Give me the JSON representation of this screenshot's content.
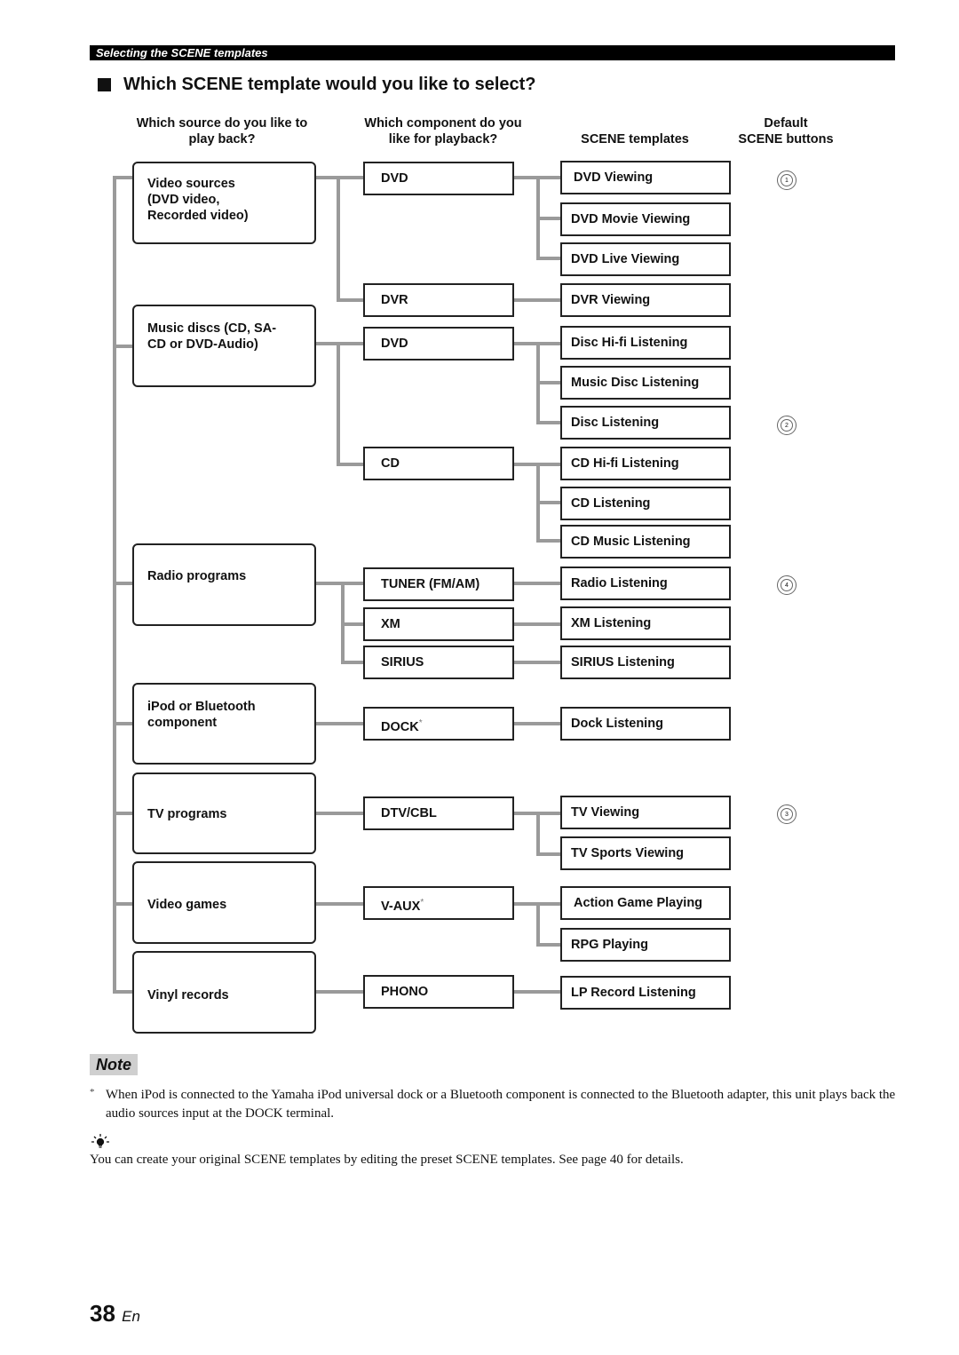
{
  "section_bar": "Selecting the SCENE templates",
  "heading": "Which SCENE template would you like to select?",
  "column_headers": {
    "source": [
      "Which source do you like to",
      "play back?"
    ],
    "component": [
      "Which component do you",
      "like for playback?"
    ],
    "templates": "SCENE templates",
    "buttons": [
      "Default",
      "SCENE buttons"
    ]
  },
  "sources": [
    {
      "lines": [
        "Video sources",
        "(DVD video,",
        "Recorded video)"
      ]
    },
    {
      "lines": [
        "Music discs (CD, SA-",
        "CD or DVD-Audio)"
      ]
    },
    {
      "lines": [
        "Radio programs"
      ]
    },
    {
      "lines": [
        "iPod or Bluetooth",
        "component"
      ]
    },
    {
      "lines": [
        "TV programs"
      ]
    },
    {
      "lines": [
        "Video games"
      ]
    },
    {
      "lines": [
        "Vinyl records"
      ]
    }
  ],
  "components": [
    {
      "label": "DVD",
      "mark": ""
    },
    {
      "label": "DVR",
      "mark": ""
    },
    {
      "label": "DVD",
      "mark": ""
    },
    {
      "label": "CD",
      "mark": ""
    },
    {
      "label": "TUNER (FM/AM)",
      "mark": ""
    },
    {
      "label": "XM",
      "mark": ""
    },
    {
      "label": "SIRIUS",
      "mark": ""
    },
    {
      "label": "DOCK",
      "mark": "*"
    },
    {
      "label": "DTV/CBL",
      "mark": ""
    },
    {
      "label": "V-AUX",
      "mark": "*"
    },
    {
      "label": "PHONO",
      "mark": ""
    }
  ],
  "templates": [
    "DVD Viewing",
    "DVD Movie Viewing",
    "DVD Live Viewing",
    "DVR Viewing",
    "Disc Hi-fi Listening",
    "Music Disc Listening",
    "Disc Listening",
    "CD Hi-fi Listening",
    "CD Listening",
    "CD Music Listening",
    "Radio Listening",
    "XM Listening",
    "SIRIUS Listening",
    "Dock Listening",
    "TV Viewing",
    "TV Sports Viewing",
    "Action Game Playing",
    "RPG Playing",
    "LP Record Listening"
  ],
  "scene_buttons": [
    {
      "number": "1",
      "template": "DVD Viewing"
    },
    {
      "number": "2",
      "template": "Disc Listening"
    },
    {
      "number": "4",
      "template": "Radio Listening"
    },
    {
      "number": "3",
      "template": "TV Viewing"
    }
  ],
  "note": {
    "label": "Note",
    "mark": "*",
    "text": "When iPod is connected to the Yamaha iPod universal dock or a Bluetooth component is connected to the Bluetooth adapter, this unit plays back the audio sources input at the DOCK terminal."
  },
  "tip": {
    "icon": "lightbulb-icon",
    "text": "You can create your original SCENE templates by editing the preset SCENE templates. See page 40 for details."
  },
  "page": {
    "number": "38",
    "lang": "En"
  },
  "colors": {
    "line": "#9a9a9a",
    "border": "#222222",
    "note_bg": "#cfcfcf"
  }
}
